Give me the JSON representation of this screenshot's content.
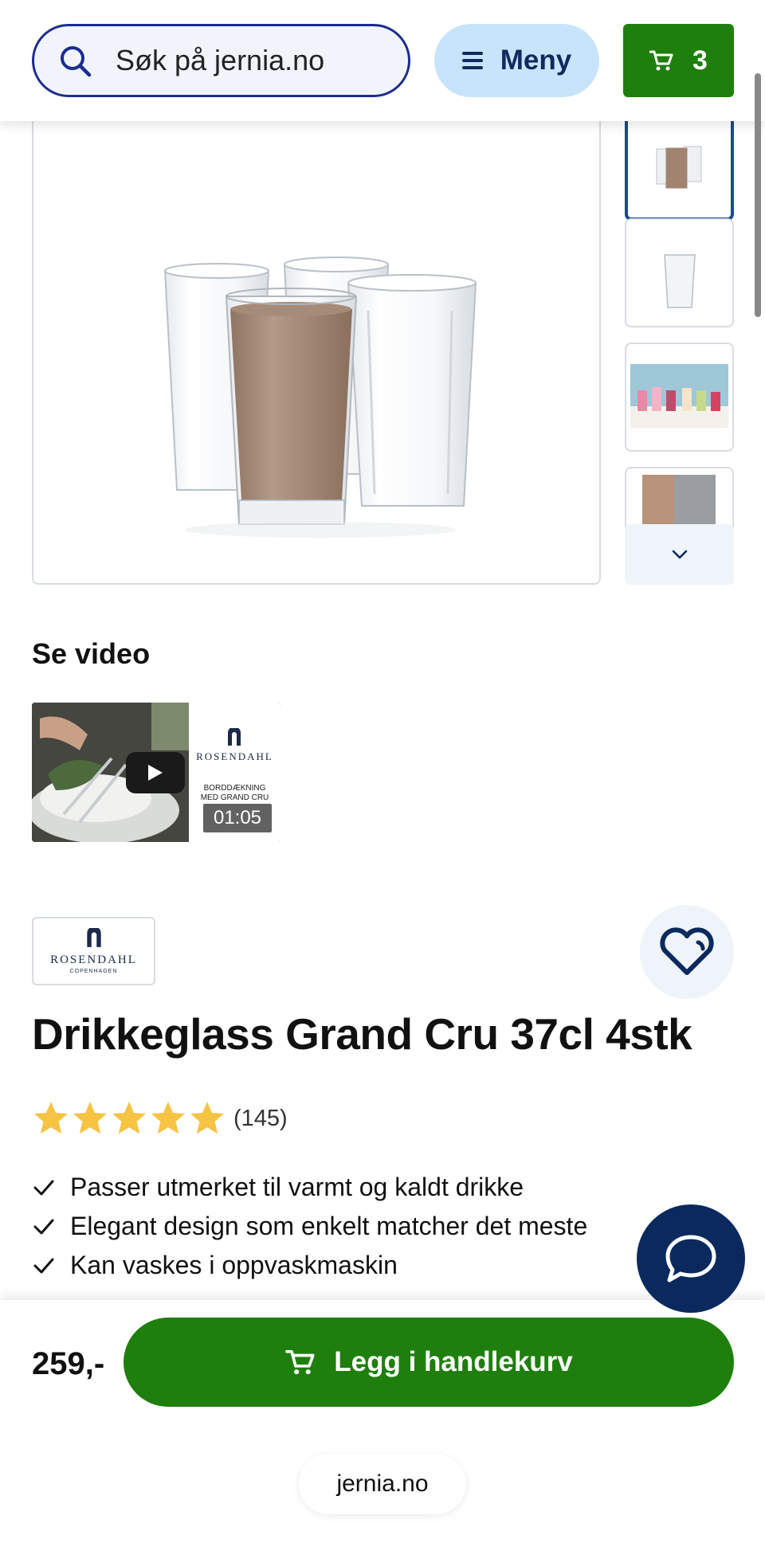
{
  "header": {
    "search_placeholder": "Søk på jernia.no",
    "menu_label": "Meny",
    "cart_count": "3",
    "icons": {
      "search": "search-icon",
      "menu": "hamburger-icon",
      "cart": "cart-icon"
    }
  },
  "gallery": {
    "thumbnail_count_visible": 4,
    "active_thumbnail": 1
  },
  "video": {
    "heading": "Se video",
    "brand": "ROSENDAHL",
    "brand_sub": "COPENHAGEN",
    "caption_line1": "BORDDÆKNING",
    "caption_line2": "MED GRAND CRU",
    "duration": "01:05"
  },
  "product": {
    "brand_name": "ROSENDAHL",
    "brand_sub": "COPENHAGEN",
    "title": "Drikkeglass Grand Cru 37cl 4stk",
    "rating_stars": 5,
    "rating_count": "(145)",
    "features": [
      "Passer utmerket til varmt og kaldt drikke",
      "Elegant design som enkelt matcher det meste",
      "Kan vaskes i oppvaskmaskin"
    ]
  },
  "purchase": {
    "price": "259,-",
    "add_to_cart": "Legg i handlekurv"
  },
  "browser": {
    "url": "jernia.no"
  },
  "colors": {
    "primary_green": "#1f7f0d",
    "navy": "#0a2a5e",
    "star": "#f6c343",
    "menu_bg": "#c7e4fb"
  }
}
